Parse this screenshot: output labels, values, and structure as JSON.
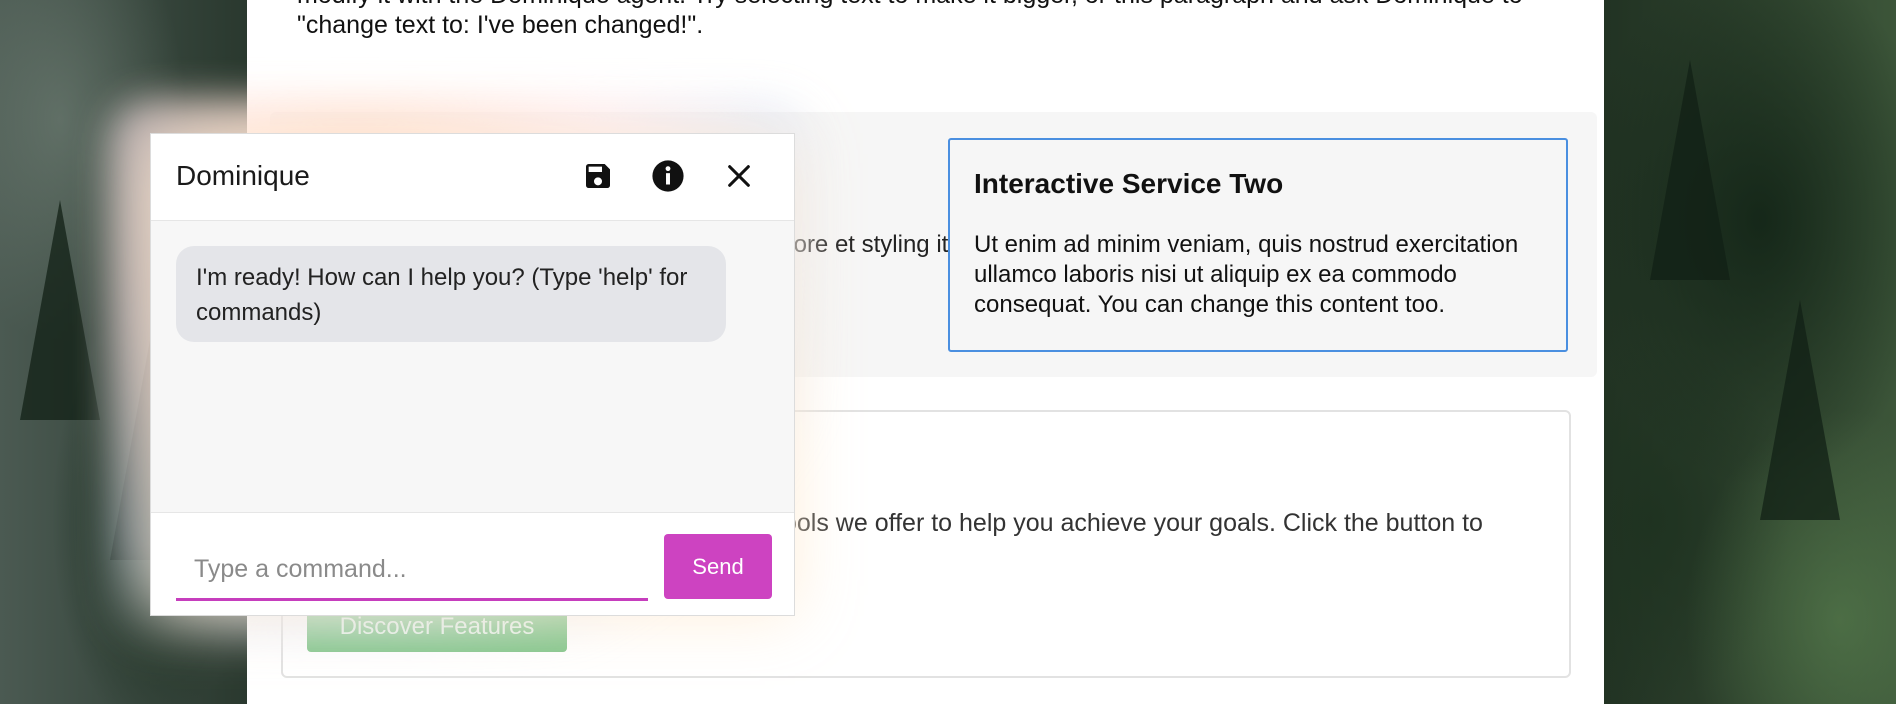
{
  "page": {
    "intro_text": "modify it with the Dominique agent. Try selecting text to make it bigger, or this paragraph and ask Dominique to \"change text to: I've been changed!\".",
    "service_one_text": "dipiscing bore et styling it.",
    "service_two": {
      "title": "Interactive Service Two",
      "body": "Ut enim ad minim veniam, quis nostrud exercitation ullamco laboris nisi ut aliquip ex ea commodo consequat. You can change this content too."
    },
    "features": {
      "text": "ools we offer to help you achieve your goals. Click the button to",
      "button_label": "Discover Features"
    }
  },
  "widget": {
    "title": "Dominique",
    "icons": [
      "save-icon",
      "info-icon",
      "close-icon"
    ],
    "message": "I'm ready! How can I help you? (Type 'help' for commands)",
    "input_placeholder": "Type a command...",
    "send_label": "Send",
    "accent_color": "#cd43c1"
  }
}
